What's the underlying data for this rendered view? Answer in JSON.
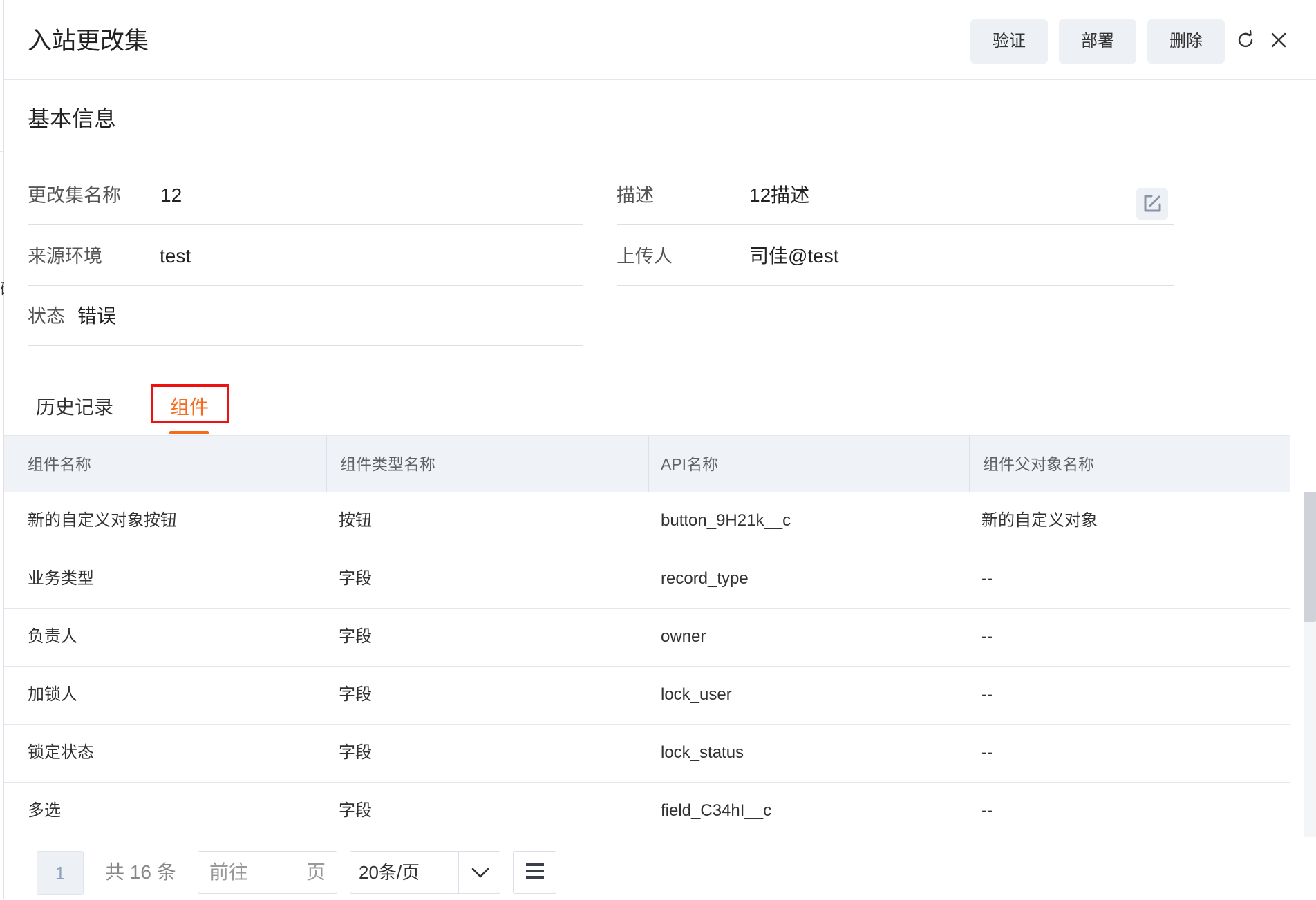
{
  "header": {
    "title": "入站更改集",
    "buttons": {
      "validate": "验证",
      "deploy": "部署",
      "delete": "删除"
    }
  },
  "section": {
    "title": "基本信息"
  },
  "form": {
    "name_label": "更改集名称",
    "name_value": "12",
    "desc_label": "描述",
    "desc_value": "12描述",
    "source_label": "来源环境",
    "source_value": "test",
    "uploader_label": "上传人",
    "uploader_value": "司佳@test",
    "status_label": "状态",
    "status_value": "错误"
  },
  "tabs": [
    {
      "label": "历史记录"
    },
    {
      "label": "组件"
    }
  ],
  "table": {
    "headers": [
      "组件名称",
      "组件类型名称",
      "API名称",
      "组件父对象名称"
    ],
    "rows": [
      [
        "新的自定义对象按钮",
        "按钮",
        "button_9H21k__c",
        "新的自定义对象"
      ],
      [
        "业务类型",
        "字段",
        "record_type",
        "--"
      ],
      [
        "负责人",
        "字段",
        "owner",
        "--"
      ],
      [
        "加锁人",
        "字段",
        "lock_user",
        "--"
      ],
      [
        "锁定状态",
        "字段",
        "lock_status",
        "--"
      ],
      [
        "多选",
        "字段",
        "field_C34hI__c",
        "--"
      ]
    ]
  },
  "pagination": {
    "current_page": "1",
    "total_text": "共 16 条",
    "goto_prefix": "前往",
    "goto_suffix": "页",
    "page_size": "20条/页"
  },
  "colors": {
    "accent": "#f56c1f",
    "highlight_box": "#ee1111",
    "button_bg": "#edf0f5"
  }
}
